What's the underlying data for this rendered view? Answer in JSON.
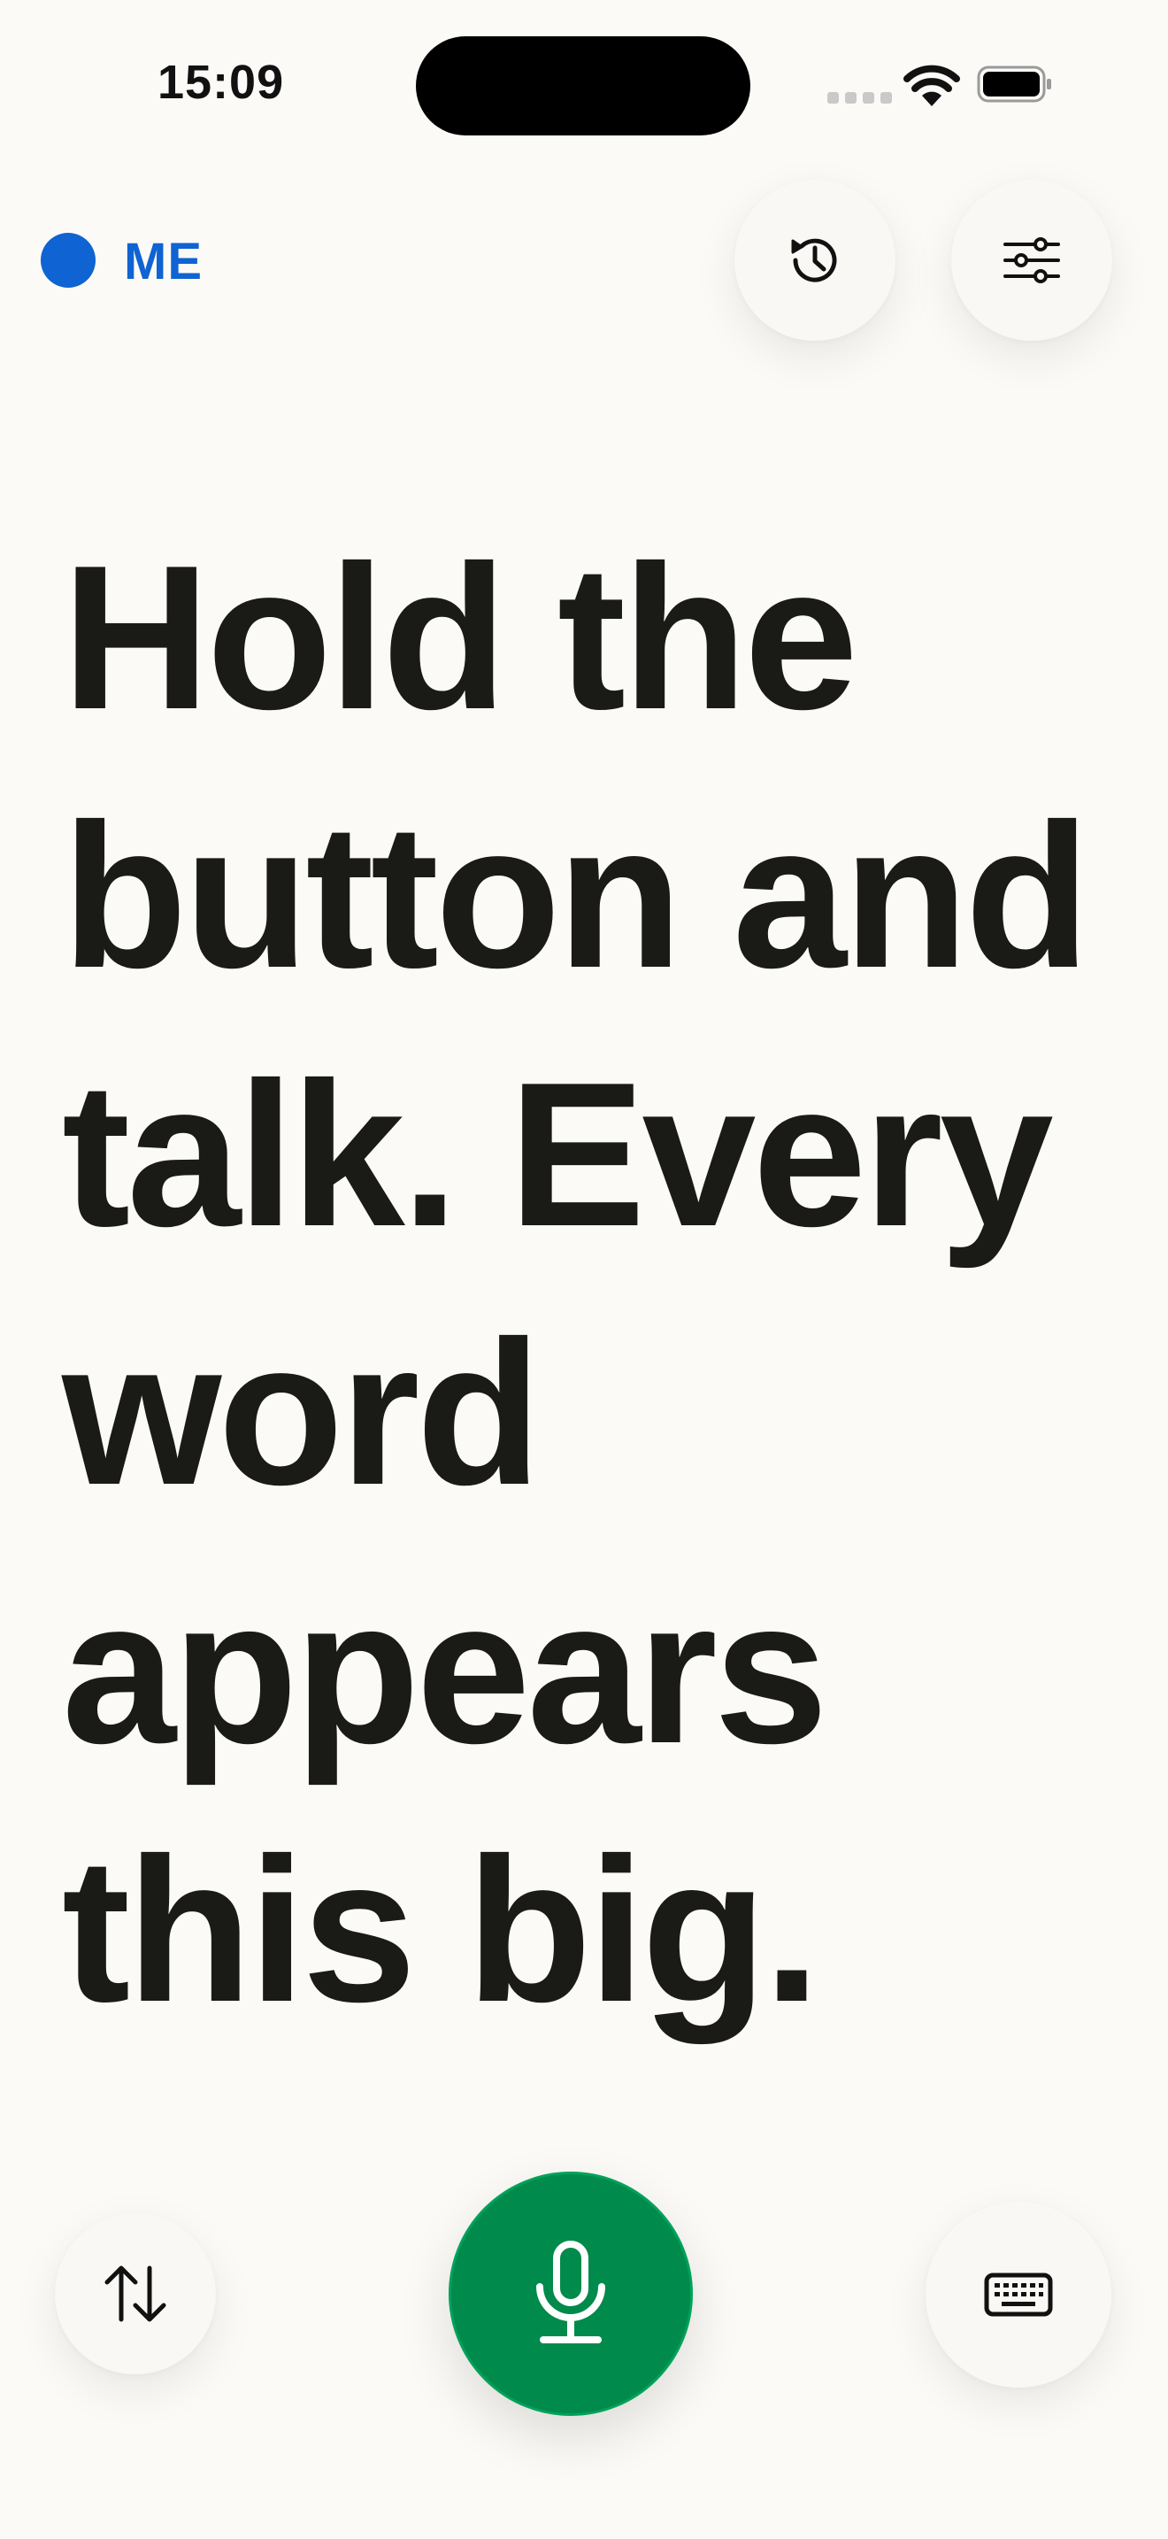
{
  "status_bar": {
    "time": "15:09"
  },
  "header": {
    "mode_label": "ME",
    "mode_color": "#0f63d2",
    "history_icon": "history-icon",
    "settings_icon": "sliders-icon"
  },
  "main": {
    "message": "Hold the button and talk. Every word appears this big."
  },
  "bottom": {
    "swap_icon": "swap-arrows-icon",
    "mic_icon": "microphone-icon",
    "mic_color": "#008a4b",
    "keyboard_icon": "keyboard-icon"
  }
}
